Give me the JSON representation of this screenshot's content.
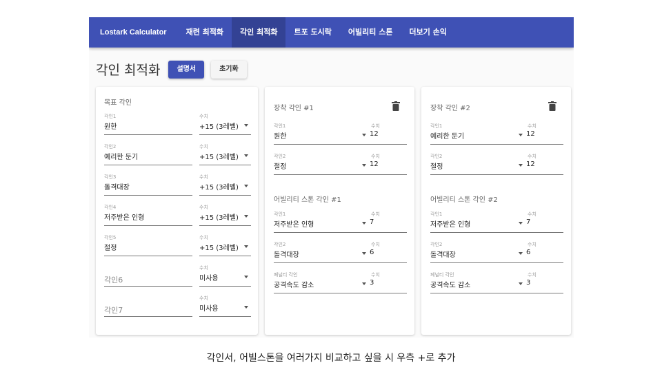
{
  "nav": {
    "brand": "Lostark Calculator",
    "items": [
      "재련 최적화",
      "각인 최적화",
      "트포 도시락",
      "어빌리티 스톤",
      "더보기 손익"
    ]
  },
  "page": {
    "title": "각인 최적화",
    "manual_button": "설명서",
    "reset_button": "초기화"
  },
  "target_card": {
    "title": "목표 각인",
    "rows": [
      {
        "label": "각인1",
        "value": "원한",
        "level_label": "수치",
        "level": "+15 (3레벨)"
      },
      {
        "label": "각인2",
        "value": "예리한 둔기",
        "level_label": "수치",
        "level": "+15 (3레벨)"
      },
      {
        "label": "각인3",
        "value": "돌격대장",
        "level_label": "수치",
        "level": "+15 (3레벨)"
      },
      {
        "label": "각인4",
        "value": "저주받은 인형",
        "level_label": "수치",
        "level": "+15 (3레벨)"
      },
      {
        "label": "각인5",
        "value": "절정",
        "level_label": "수치",
        "level": "+15 (3레벨)"
      },
      {
        "label": "",
        "value": "각인6",
        "level_label": "수치",
        "level": "미사용"
      },
      {
        "label": "",
        "value": "각인7",
        "level_label": "수치",
        "level": "미사용"
      }
    ]
  },
  "option_cards": [
    {
      "equip_title": "장착 각인 #1",
      "equip": [
        {
          "label": "각인1",
          "value": "원한",
          "level_label": "수치",
          "level": "12"
        },
        {
          "label": "각인2",
          "value": "절정",
          "level_label": "수치",
          "level": "12"
        }
      ],
      "stone_title": "어빌리티 스톤 각인 #1",
      "stone": [
        {
          "label": "각인1",
          "value": "저주받은 인형",
          "level_label": "수치",
          "level": "7"
        },
        {
          "label": "각인2",
          "value": "돌격대장",
          "level_label": "수치",
          "level": "6"
        },
        {
          "label": "페널티 각인",
          "value": "공격속도 감소",
          "level_label": "수치",
          "level": "3"
        }
      ]
    },
    {
      "equip_title": "장착 각인 #2",
      "equip": [
        {
          "label": "각인1",
          "value": "예리한 둔기",
          "level_label": "수치",
          "level": "12"
        },
        {
          "label": "각인2",
          "value": "절정",
          "level_label": "수치",
          "level": "12"
        }
      ],
      "stone_title": "어빌리티 스톤 각인 #2",
      "stone": [
        {
          "label": "각인1",
          "value": "저주받은 인형",
          "level_label": "수치",
          "level": "7"
        },
        {
          "label": "각인2",
          "value": "돌격대장",
          "level_label": "수치",
          "level": "6"
        },
        {
          "label": "페널티 각인",
          "value": "공격속도 감소",
          "level_label": "수치",
          "level": "3"
        }
      ]
    }
  ],
  "caption": "각인서, 어빌스톤을 여러가지 비교하고 싶을 시 우측 +로 추가",
  "icons": {
    "delete": "trash-icon",
    "dropdown": "dropdown-arrow-icon"
  },
  "colors": {
    "primary": "#3f51b5",
    "underline": "#777777"
  }
}
